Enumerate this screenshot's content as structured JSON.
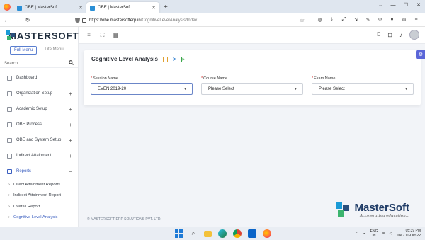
{
  "browser": {
    "tabs": [
      {
        "title": "OBE | MasterSoft",
        "active": false
      },
      {
        "title": "OBE | MasterSoft",
        "active": true
      }
    ],
    "url_host": "https://obe.mastersofterp.in",
    "url_path": "/CognitiveLevelAnalysis/Index"
  },
  "sidebar": {
    "brand": "MASTERSOFT",
    "menu_modes": [
      "Full Menu",
      "Lite Menu"
    ],
    "search_placeholder": "Search",
    "items": [
      {
        "label": "Dashboard",
        "expandable": false
      },
      {
        "label": "Organization Setup",
        "expandable": true
      },
      {
        "label": "Academic Setup",
        "expandable": true
      },
      {
        "label": "OBE Process",
        "expandable": true
      },
      {
        "label": "OBE and System Setup",
        "expandable": true
      },
      {
        "label": "Indirect Attainment",
        "expandable": true
      },
      {
        "label": "Reports",
        "expandable": true,
        "open": true
      }
    ],
    "sub_items": [
      "Direct Attainment Reports",
      "Indirect Attainment Report",
      "Overall Report",
      "Cognitive Level Analysis"
    ]
  },
  "page": {
    "title": "Cognitive Level Analysis",
    "fields": [
      {
        "label": "Session Name",
        "value": "EVEN 2019-20"
      },
      {
        "label": "Course Name",
        "value": "Please Select"
      },
      {
        "label": "Exam Name",
        "value": "Please Select"
      }
    ]
  },
  "footer": {
    "copyright": "© MASTERSOFT ERP SOLUTIONS PVT. LTD.",
    "logo_name": "MasterSoft",
    "tagline": "Accelerating education..."
  },
  "taskbar": {
    "lang_line1": "ENG",
    "lang_line2": "IN",
    "time": "05:39 PM",
    "date": "Tue / 11-Oct-22"
  },
  "colors": {
    "accent": "#3b5fc0",
    "brand_blue": "#1a9ad6",
    "brand_navy": "#2a4f7c",
    "brand_green": "#3cb46e"
  }
}
